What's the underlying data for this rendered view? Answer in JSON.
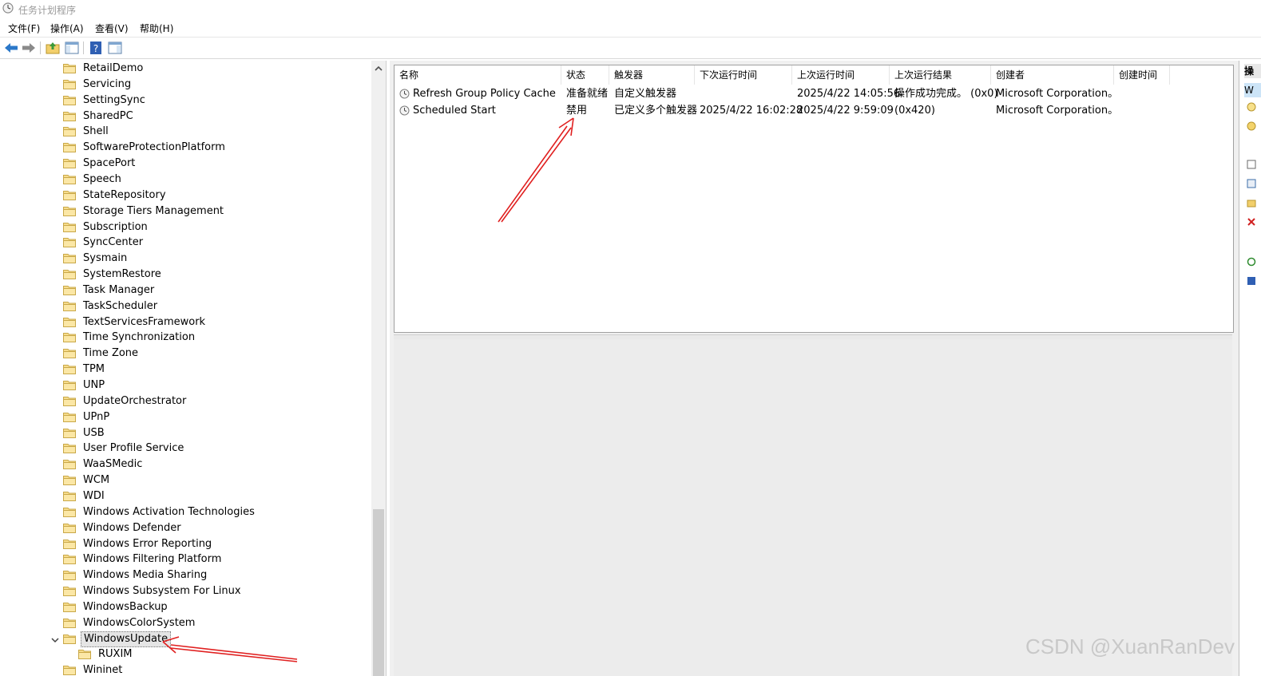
{
  "window": {
    "title": "任务计划程序"
  },
  "menu": [
    "文件(F)",
    "操作(A)",
    "查看(V)",
    "帮助(H)"
  ],
  "toolbar": {
    "buttons": [
      "back-arrow-icon",
      "forward-arrow-icon",
      "up-folder-icon",
      "show-hide-tree-icon",
      "help-icon",
      "show-hide-action-pane-icon"
    ]
  },
  "tree": {
    "items": [
      {
        "label": "RetailDemo"
      },
      {
        "label": "Servicing"
      },
      {
        "label": "SettingSync"
      },
      {
        "label": "SharedPC"
      },
      {
        "label": "Shell"
      },
      {
        "label": "SoftwareProtectionPlatform"
      },
      {
        "label": "SpacePort"
      },
      {
        "label": "Speech"
      },
      {
        "label": "StateRepository"
      },
      {
        "label": "Storage Tiers Management"
      },
      {
        "label": "Subscription"
      },
      {
        "label": "SyncCenter"
      },
      {
        "label": "Sysmain"
      },
      {
        "label": "SystemRestore"
      },
      {
        "label": "Task Manager"
      },
      {
        "label": "TaskScheduler"
      },
      {
        "label": "TextServicesFramework"
      },
      {
        "label": "Time Synchronization"
      },
      {
        "label": "Time Zone"
      },
      {
        "label": "TPM"
      },
      {
        "label": "UNP"
      },
      {
        "label": "UpdateOrchestrator"
      },
      {
        "label": "UPnP"
      },
      {
        "label": "USB"
      },
      {
        "label": "User Profile Service"
      },
      {
        "label": "WaaSMedic"
      },
      {
        "label": "WCM"
      },
      {
        "label": "WDI"
      },
      {
        "label": "Windows Activation Technologies"
      },
      {
        "label": "Windows Defender"
      },
      {
        "label": "Windows Error Reporting"
      },
      {
        "label": "Windows Filtering Platform"
      },
      {
        "label": "Windows Media Sharing"
      },
      {
        "label": "Windows Subsystem For Linux"
      },
      {
        "label": "WindowsBackup"
      },
      {
        "label": "WindowsColorSystem"
      },
      {
        "label": "WindowsUpdate",
        "selected": true,
        "expanded": true
      },
      {
        "label": "RUXIM",
        "child": true
      },
      {
        "label": "Wininet"
      }
    ]
  },
  "table": {
    "columns": [
      "名称",
      "状态",
      "触发器",
      "下次运行时间",
      "上次运行时间",
      "上次运行结果",
      "创建者",
      "创建时间"
    ],
    "rows": [
      {
        "name": "Refresh Group Policy Cache",
        "status": "准备就绪",
        "trigger": "自定义触发器",
        "next_run": "",
        "last_run": "2025/4/22 14:05:56",
        "last_result": "操作成功完成。 (0x0)",
        "author": "Microsoft Corporation。",
        "created": ""
      },
      {
        "name": "Scheduled Start",
        "status": "禁用",
        "trigger": "已定义多个触发器",
        "next_run": "2025/4/22 16:02:28",
        "last_run": "2025/4/22 9:59:09",
        "last_result": "(0x420)",
        "author": "Microsoft Corporation。",
        "created": ""
      }
    ]
  },
  "action_pane": {
    "header": "操",
    "selected": "W"
  },
  "colors": {
    "arrow": "#e02020",
    "selected_tree_bg": "#e5e5e5",
    "folder": "#f5d77a"
  },
  "watermark": "CSDN @XuanRanDev"
}
